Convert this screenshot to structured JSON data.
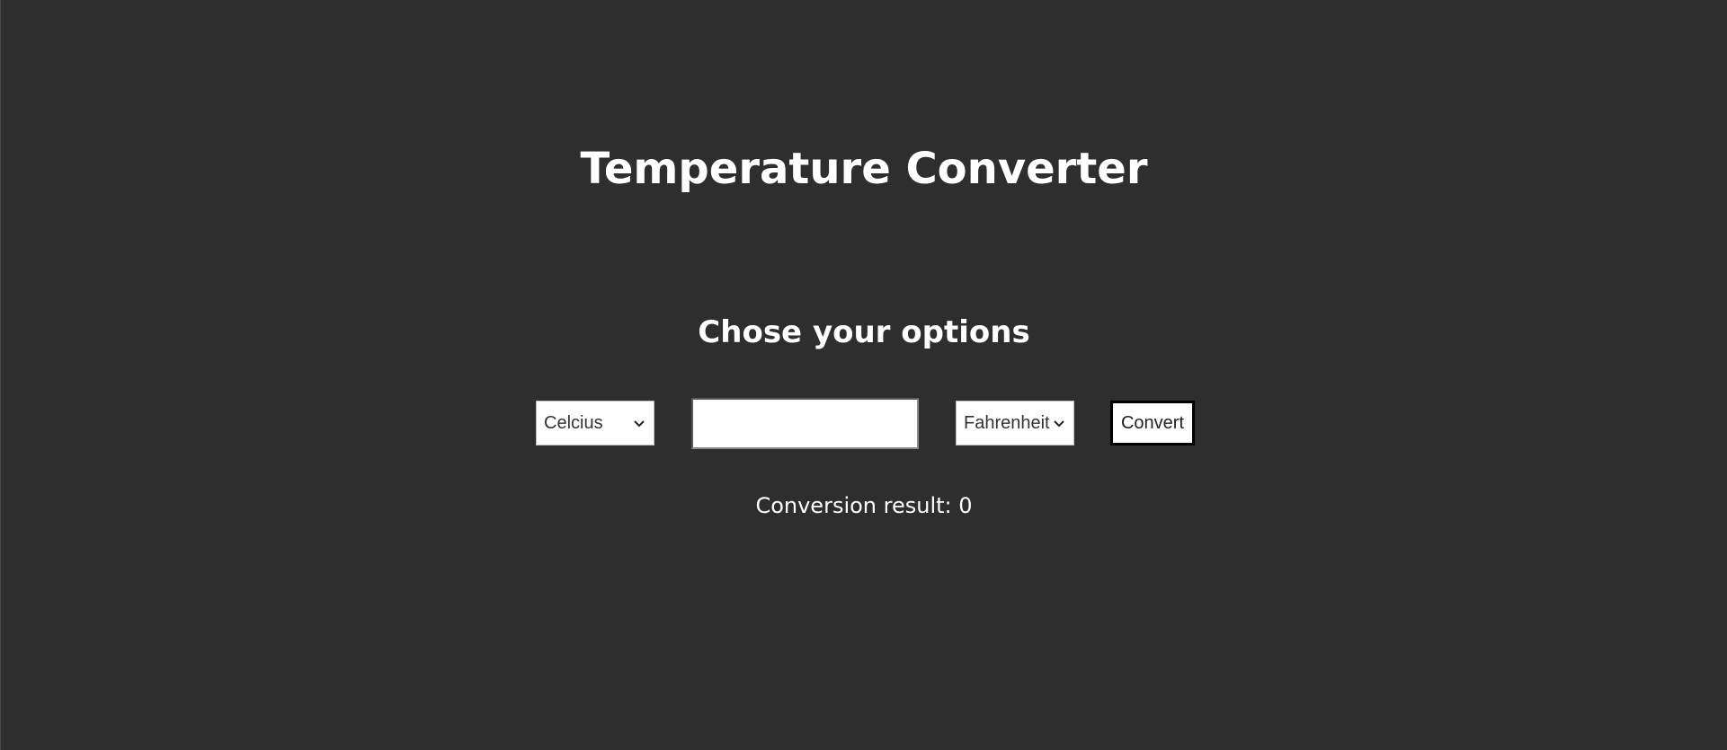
{
  "app": {
    "title": "Temperature Converter",
    "subtitle": "Chose your options"
  },
  "controls": {
    "from_unit": {
      "selected": "Celcius",
      "icon": "chevron-down-icon"
    },
    "value_input": {
      "value": "",
      "placeholder": ""
    },
    "to_unit": {
      "selected": "Fahrenheit",
      "icon": "chevron-down-icon"
    },
    "convert_label": "Convert"
  },
  "result": {
    "label": "Conversion result:",
    "value": "0"
  },
  "colors": {
    "background": "#2e2e2e",
    "text": "#ffffff",
    "control_bg": "#ffffff"
  }
}
